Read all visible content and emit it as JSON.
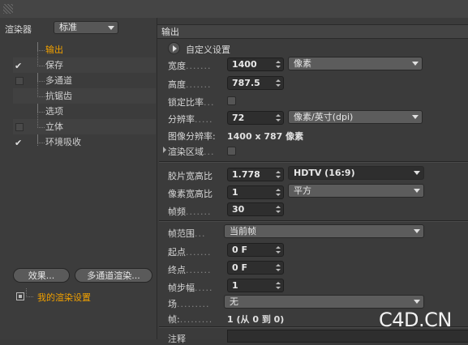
{
  "left_panel": {
    "renderer_label": "渲染器",
    "renderer_value": "标准",
    "tree": [
      {
        "label": "输出",
        "check": "none",
        "selected": true
      },
      {
        "label": "保存",
        "check": "on",
        "selected": false
      },
      {
        "label": "多通道",
        "check": "off",
        "selected": false
      },
      {
        "label": "抗锯齿",
        "check": "none",
        "selected": false
      },
      {
        "label": "选项",
        "check": "none",
        "selected": false
      },
      {
        "label": "立体",
        "check": "off",
        "selected": false
      },
      {
        "label": "环境吸收",
        "check": "on",
        "selected": false
      }
    ],
    "effects_button": "效果...",
    "multipass_button": "多通道渲染...",
    "render_setting_label": "我的渲染设置"
  },
  "output": {
    "title": "输出",
    "custom_settings": "自定义设置",
    "width_label": "宽度",
    "width_value": "1400",
    "width_unit": "像素",
    "height_label": "高度",
    "height_value": "787.5",
    "lock_ratio_label": "锁定比率",
    "resolution_label": "分辨率",
    "resolution_value": "72",
    "resolution_unit": "像素/英寸(dpi)",
    "image_resolution_label": "图像分辨率:",
    "image_resolution_value": "1400 x 787 像素",
    "render_region_label": "渲染区域",
    "film_aspect_label": "胶片宽高比",
    "film_aspect_value": "1.778",
    "film_aspect_preset": "HDTV (16:9)",
    "pixel_aspect_label": "像素宽高比",
    "pixel_aspect_value": "1",
    "pixel_aspect_preset": "平方",
    "fps_label": "帧频",
    "fps_value": "30",
    "frame_range_label": "帧范围",
    "frame_range_value": "当前帧",
    "start_label": "起点",
    "start_value": "0 F",
    "end_label": "终点",
    "end_value": "0 F",
    "frame_step_label": "帧步幅",
    "frame_step_value": "1",
    "field_label": "场",
    "field_value": "无",
    "frames_label": "帧:",
    "frames_value": "1 (从 0 到 0)",
    "note_label": "注释"
  },
  "watermark": "C4D.CN"
}
